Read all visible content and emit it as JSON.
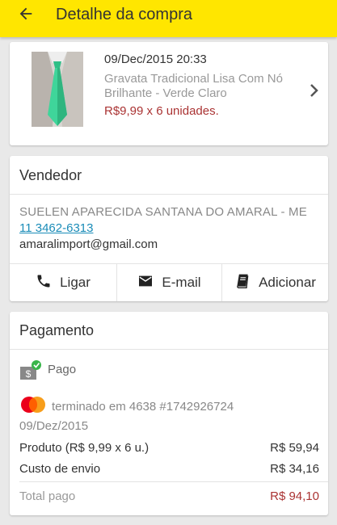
{
  "header": {
    "title": "Detalhe da compra",
    "back_icon": "arrow-left-icon",
    "background": "#ffe600"
  },
  "product": {
    "date": "09/Dec/2015 20:33",
    "name": "Gravata Tradicional Lisa Com Nó Brilhante - Verde Claro",
    "price_qty": "R$9,99 x 6 unidades.",
    "price_color": "#aa3333"
  },
  "seller": {
    "title": "Vendedor",
    "name": "SUELEN APARECIDA  SANTANA DO AMARAL - ME",
    "phone": "11 3462-6313",
    "email": "amaralimport@gmail.com",
    "actions": {
      "call": "Ligar",
      "email": "E-mail",
      "add": "Adicionar"
    }
  },
  "payment": {
    "title": "Pagamento",
    "status": "Pago",
    "card_text": "terminado em 4638  #1742926724",
    "card_brand": "Mastercard",
    "card_date": "09/Dez/2015",
    "product_label": "Produto (R$ 9,99 x 6 u.)",
    "product_value": "R$ 59,94",
    "shipping_label": "Custo de envio",
    "shipping_value": "R$ 34,16",
    "total_label": "Total pago",
    "total_value": "R$ 94,10"
  }
}
